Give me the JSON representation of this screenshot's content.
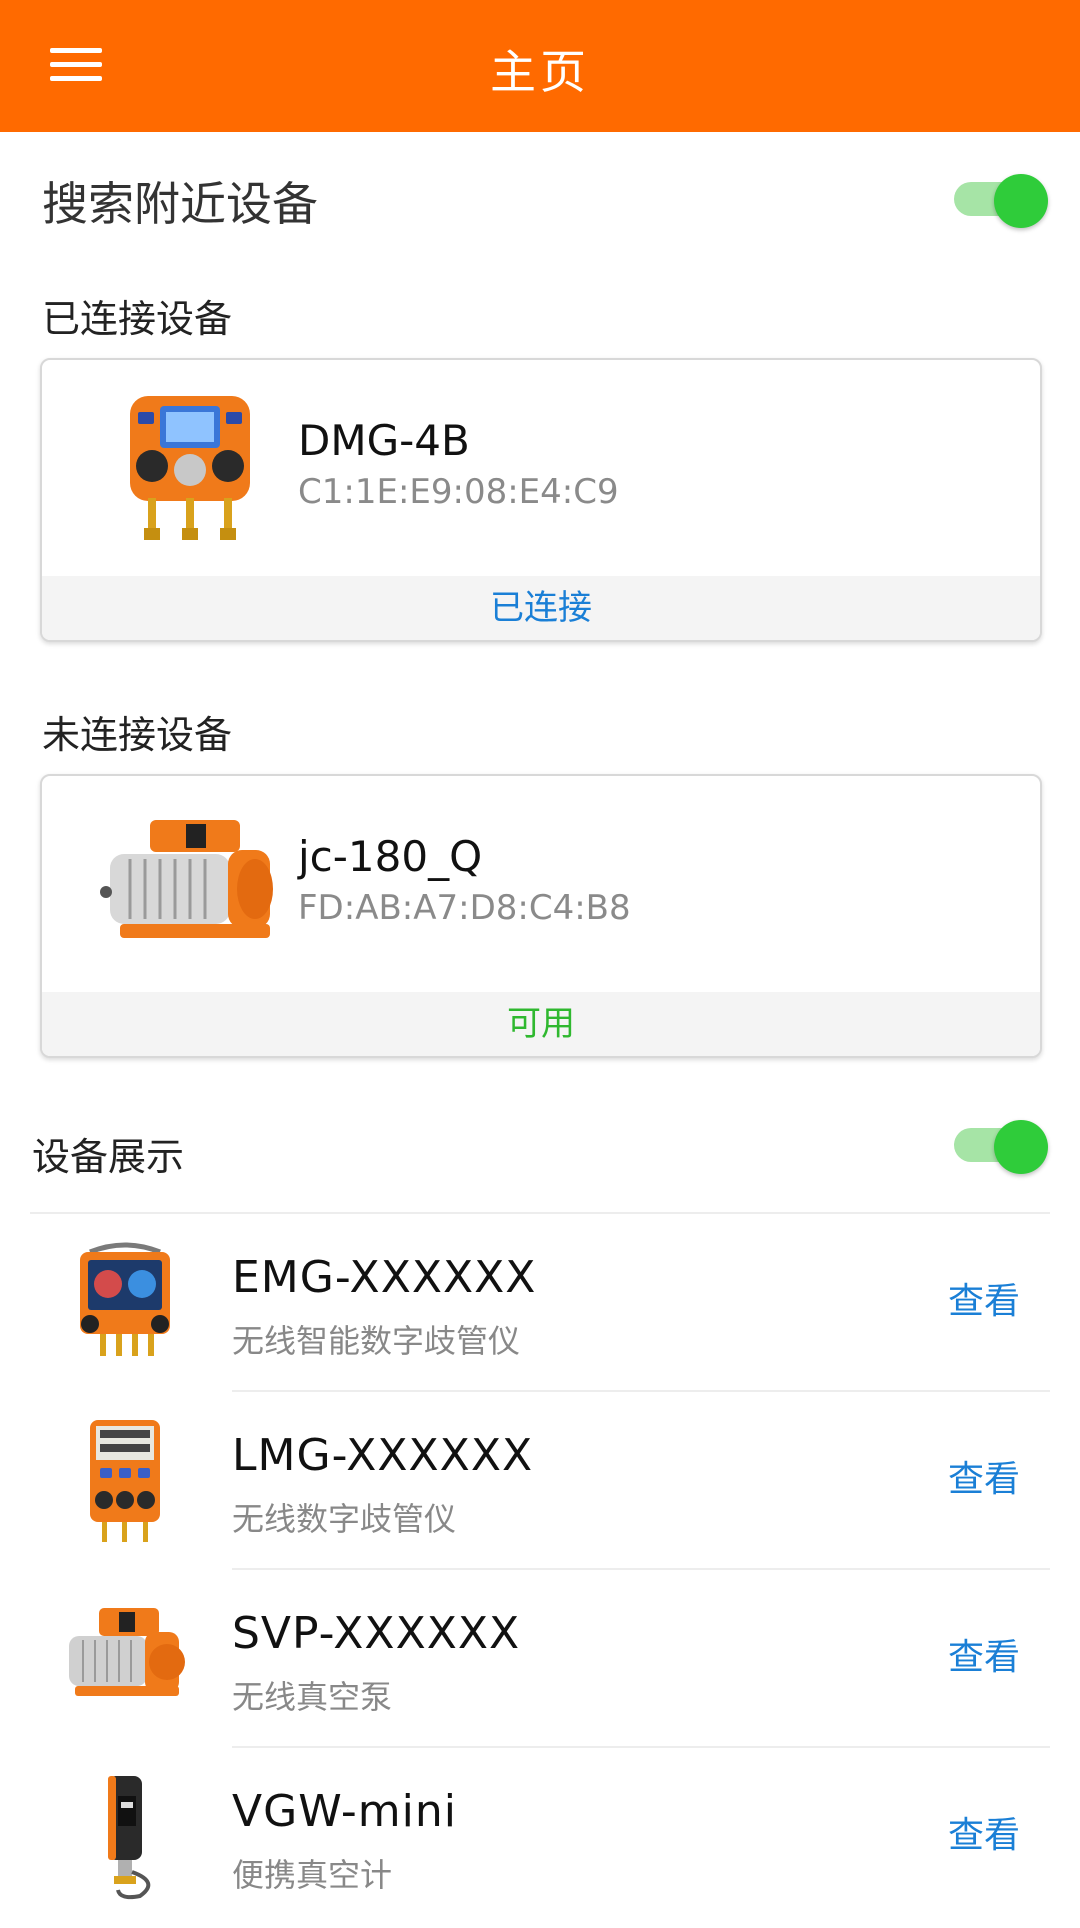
{
  "header": {
    "title": "主页"
  },
  "search": {
    "label": "搜索附近设备",
    "enabled": true
  },
  "connected": {
    "section_label": "已连接设备",
    "device": {
      "name": "DMG-4B",
      "mac": "C1:1E:E9:08:E4:C9",
      "status": "已连接",
      "status_color": "#1a7fd6"
    }
  },
  "disconnected": {
    "section_label": "未连接设备",
    "device": {
      "name": "jc-180_Q",
      "mac": "FD:AB:A7:D8:C4:B8",
      "status": "可用",
      "status_color": "#2fb82f"
    }
  },
  "showcase": {
    "label": "设备展示",
    "enabled": true,
    "items": [
      {
        "name": "EMG-XXXXXX",
        "desc": "无线智能数字歧管仪",
        "action": "查看"
      },
      {
        "name": "LMG-XXXXXX",
        "desc": "无线数字歧管仪",
        "action": "查看"
      },
      {
        "name": "SVP-XXXXXX",
        "desc": "无线真空泵",
        "action": "查看"
      },
      {
        "name": "VGW-mini",
        "desc": "便携真空计",
        "action": "查看"
      }
    ]
  },
  "colors": {
    "accent": "#ff6a00",
    "link": "#1a7fd6",
    "toggle_on": "#2fcc3a"
  }
}
